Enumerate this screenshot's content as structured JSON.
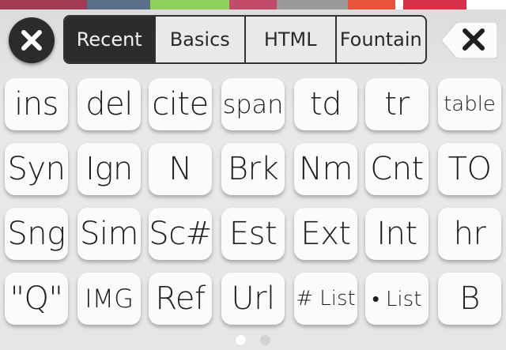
{
  "bg_strip": [
    {
      "color": "#a03a55",
      "w": 110
    },
    {
      "color": "#5a6f8a",
      "w": 80
    },
    {
      "color": "#8fd05a",
      "w": 100
    },
    {
      "color": "#c24a6a",
      "w": 60
    },
    {
      "color": "#9a9a9a",
      "w": 90
    },
    {
      "color": "#e8533a",
      "w": 60
    },
    {
      "color": "#ffffff",
      "w": 10
    },
    {
      "color": "#d9304a",
      "w": 80
    },
    {
      "color": "#ffffff",
      "w": 50
    }
  ],
  "close_button": {
    "icon": "close-icon"
  },
  "tabs": [
    {
      "label": "Recent",
      "active": true
    },
    {
      "label": "Basics",
      "active": false
    },
    {
      "label": "HTML",
      "active": false
    },
    {
      "label": "Fountain",
      "active": false
    }
  ],
  "backspace": {
    "icon": "backspace-icon"
  },
  "keys": [
    [
      {
        "label": "ins",
        "size": "l"
      },
      {
        "label": "del",
        "size": "l"
      },
      {
        "label": "cite",
        "size": "l"
      },
      {
        "label": "span",
        "size": "m"
      },
      {
        "label": "td",
        "size": "l"
      },
      {
        "label": "tr",
        "size": "l"
      },
      {
        "label": "table",
        "size": "s"
      }
    ],
    [
      {
        "label": "Syn",
        "size": "l"
      },
      {
        "label": "Ign",
        "size": "l"
      },
      {
        "label": "N",
        "size": "l"
      },
      {
        "label": "Brk",
        "size": "l"
      },
      {
        "label": "Nm",
        "size": "l"
      },
      {
        "label": "Cnt",
        "size": "l"
      },
      {
        "label": "TO",
        "size": "l"
      }
    ],
    [
      {
        "label": "Sng",
        "size": "l"
      },
      {
        "label": "Sim",
        "size": "l"
      },
      {
        "label": "Sc#",
        "size": "l"
      },
      {
        "label": "Est",
        "size": "l"
      },
      {
        "label": "Ext",
        "size": "l"
      },
      {
        "label": "Int",
        "size": "l"
      },
      {
        "label": "hr",
        "size": "l"
      }
    ],
    [
      {
        "label": "\"Q\"",
        "size": "l"
      },
      {
        "label": "IMG",
        "size": "m"
      },
      {
        "label": "Ref",
        "size": "l"
      },
      {
        "label": "Url",
        "size": "l"
      },
      {
        "label": "# List",
        "size": "s"
      },
      {
        "label": "• List",
        "size": "s"
      },
      {
        "label": "B",
        "size": "l"
      }
    ]
  ],
  "page_indicator": {
    "pages": 2,
    "current": 1
  }
}
